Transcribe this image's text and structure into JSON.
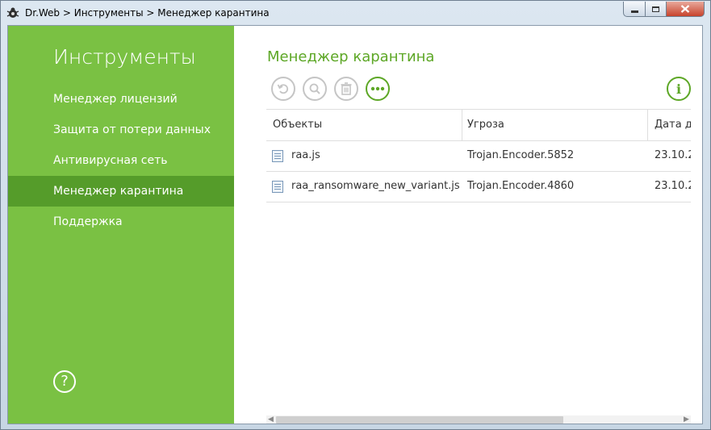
{
  "window": {
    "title": "Dr.Web > Инструменты > Менеджер карантина"
  },
  "sidebar": {
    "title": "Инструменты",
    "items": [
      {
        "label": "Менеджер лицензий"
      },
      {
        "label": "Защита от потери данных"
      },
      {
        "label": "Антивирусная сеть"
      },
      {
        "label": "Менеджер карантина",
        "active": true
      },
      {
        "label": "Поддержка"
      }
    ],
    "help_label": "?"
  },
  "main": {
    "title": "Менеджер карантина",
    "toolbar": {
      "restore_icon": "restore-icon",
      "scan_icon": "search-icon",
      "delete_icon": "trash-icon",
      "more_icon": "more-icon",
      "info_label": "i"
    },
    "table": {
      "headers": [
        "Объекты",
        "Угроза",
        "Дата д"
      ],
      "rows": [
        {
          "object": "raa.js",
          "threat": "Trojan.Encoder.5852",
          "date": "23.10.2"
        },
        {
          "object": "raa_ransomware_new_variant.js",
          "threat": "Trojan.Encoder.4860",
          "date": "23.10.2"
        }
      ]
    }
  },
  "colors": {
    "sidebar": "#7ac143",
    "sidebar_active": "#559c2a",
    "accent": "#5da726"
  }
}
